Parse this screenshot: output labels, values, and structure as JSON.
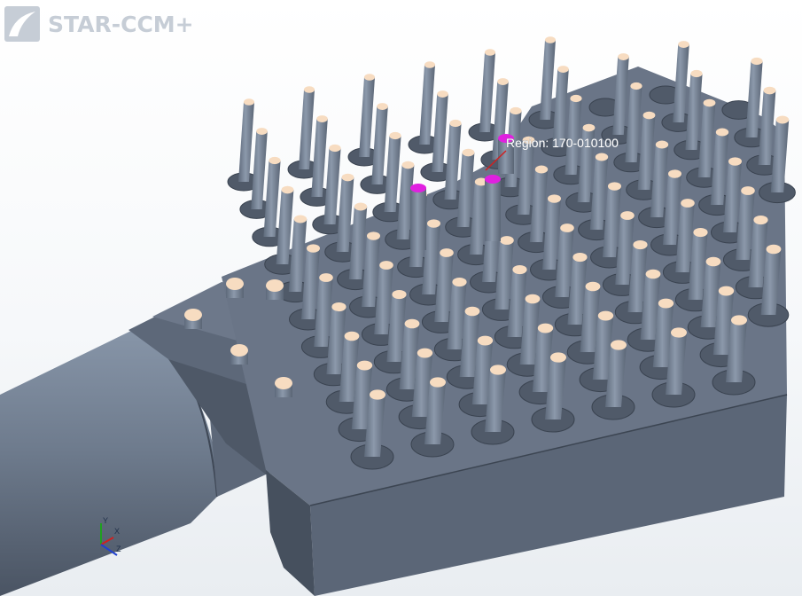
{
  "app": {
    "name": "STAR-CCM+",
    "logo_icon": "star-ccm-logo-icon"
  },
  "annotation": {
    "label": "Region: 170-010100",
    "marker_color": "#e020e0"
  },
  "axes": {
    "x": "X",
    "y": "Y",
    "z": "Z"
  },
  "colors": {
    "solid_top": "#6a7587",
    "solid_side": "#4c5666",
    "solid_front": "#5d6879",
    "pin_body": "#7b8798",
    "pin_tip": "#f7dcc1",
    "selected_tip": "#e020e0"
  }
}
